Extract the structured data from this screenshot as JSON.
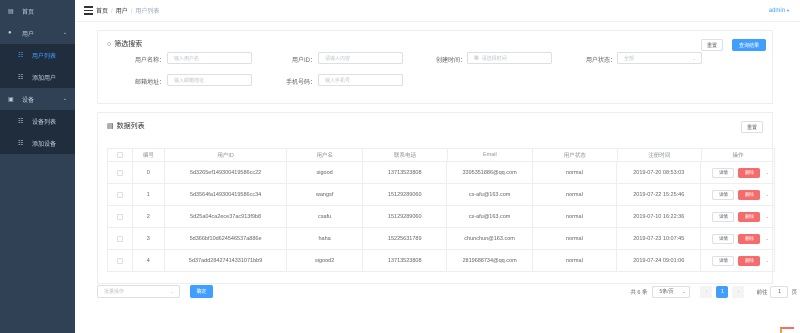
{
  "sidebar": {
    "home": "首页",
    "user": "用户",
    "user_list": "用户列表",
    "add_user": "添加用户",
    "device": "设备",
    "device_list": "设备列表",
    "add_device": "添加设备"
  },
  "navbar": {
    "crumbs": [
      "首页",
      "用户",
      "用户列表"
    ],
    "separator": "/",
    "user": "admin"
  },
  "filter": {
    "title": "筛选搜索",
    "reset": "重置",
    "search": "查询结果",
    "fields": {
      "username": {
        "label": "用户名称：",
        "placeholder": "输入用户名"
      },
      "userid": {
        "label": "用户ID：",
        "placeholder": "请输入内容"
      },
      "created": {
        "label": "创建时间：",
        "placeholder": "请选择时间"
      },
      "status": {
        "label": "用户状态：",
        "placeholder": "全部"
      },
      "email": {
        "label": "邮箱地址：",
        "placeholder": "输入邮箱地址"
      },
      "phone": {
        "label": "手机号码：",
        "placeholder": "输入手机号"
      }
    }
  },
  "list": {
    "title": "数据列表",
    "reset": "重置",
    "columns": [
      "",
      "编号",
      "用户ID",
      "用户名",
      "联系电话",
      "Email",
      "用户状态",
      "注册时间",
      "操作"
    ],
    "detail": "详情",
    "delete": "删除",
    "rows": [
      {
        "no": "0",
        "id": "5d3265ef149300419586cc22",
        "name": "sigood",
        "phone": "13713523808",
        "email": "3395351886@qq.com",
        "status": "normal",
        "time": "2019-07-20 08:53:03"
      },
      {
        "no": "1",
        "id": "5d3564fa149300419586cc34",
        "name": "wangsf",
        "phone": "15129289060",
        "email": "cs-afu@163.com",
        "status": "normal",
        "time": "2019-07-22 15:25:46"
      },
      {
        "no": "2",
        "id": "5d25a04ca2ece37ac913f9b8",
        "name": "csafu",
        "phone": "15129289060",
        "email": "cs-afu@163.com",
        "status": "normal",
        "time": "2019-07-10 16:22:36"
      },
      {
        "no": "3",
        "id": "5d366bf10d624546537a886e",
        "name": "haha",
        "phone": "15225631789",
        "email": "chunchun@163.com",
        "status": "normal",
        "time": "2019-07-23 10:07:45"
      },
      {
        "no": "4",
        "id": "5d37add28427414331071bb9",
        "name": "sigood2",
        "phone": "13713523808",
        "email": "2819688734@qq.com",
        "status": "normal",
        "time": "2019-07-24 09:01:06"
      }
    ]
  },
  "bottom": {
    "batch_placeholder": "批量操作",
    "confirm": "确定",
    "total": "共 6 条",
    "page_size": "5条/页",
    "current_page": "1",
    "goto_prefix": "前往",
    "goto_value": "1",
    "goto_suffix": "页"
  }
}
